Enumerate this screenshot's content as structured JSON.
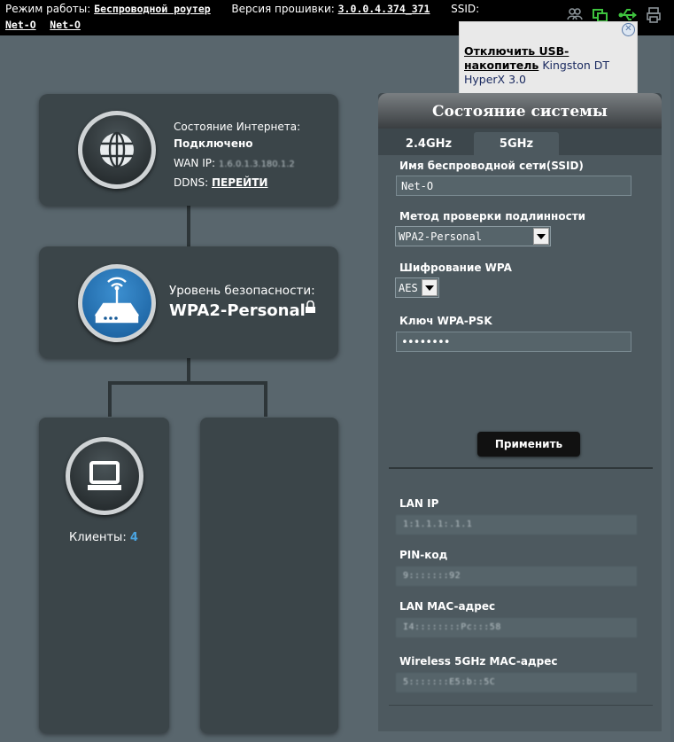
{
  "topbar": {
    "mode_label": "Режим работы:",
    "mode_value": "Беспроводной роутер",
    "firmware_label": "Версия прошивки:",
    "firmware_value": "3.0.0.4.374_371",
    "ssid_label": "SSID:",
    "ssid_1": "Net-O",
    "ssid_2": "Net-O",
    "icons": [
      "users-icon",
      "network-status-icon",
      "usb-icon",
      "printer-icon"
    ]
  },
  "usb_tooltip": {
    "action": "Отключить USB-накопитель",
    "device": "Kingston DT HyperX 3.0"
  },
  "internet_card": {
    "status_label": "Состояние Интернета:",
    "status_value": "Подключено",
    "wan_ip_label": "WAN IP:",
    "wan_ip_value": "1.6.0.1.3.180.1.2",
    "ddns_label": "DDNS:",
    "ddns_link": "ПЕРЕЙТИ",
    "icon": "globe-icon"
  },
  "router_card": {
    "security_label": "Уровень безопасности:",
    "security_value": "WPA2-Personal",
    "icon": "router-icon"
  },
  "clients_card": {
    "label": "Клиенты:",
    "count": "4",
    "icon": "computer-icon"
  },
  "system_status": {
    "title": "Состояние системы",
    "tabs": [
      "2.4GHz",
      "5GHz"
    ],
    "active_tab": "5GHz",
    "ssid_label": "Имя беспроводной сети(SSID)",
    "ssid_value": "Net-O",
    "auth_label": "Метод проверки подлинности",
    "auth_value": "WPA2-Personal",
    "wpa_enc_label": "Шифрование WPA",
    "wpa_enc_value": "AES",
    "psk_label": "Ключ WPA-PSK",
    "psk_value": "••••••••",
    "apply_label": "Применить",
    "lan_ip_label": "LAN IP",
    "lan_ip_value": "1:1.1.1:.1.1",
    "pin_label": "PIN-код",
    "pin_value": "9:::::::92",
    "lan_mac_label": "LAN MAC-адрес",
    "lan_mac_value": "I4::::::::Pc:::58",
    "wifi_mac_label": "Wireless 5GHz MAC-адрес",
    "wifi_mac_value": "5:::::::E5:b::5C"
  },
  "colors": {
    "background": "#5c6a70",
    "card": "#3b4549",
    "panel": "#4d595f",
    "accent": "#4aa3df"
  }
}
